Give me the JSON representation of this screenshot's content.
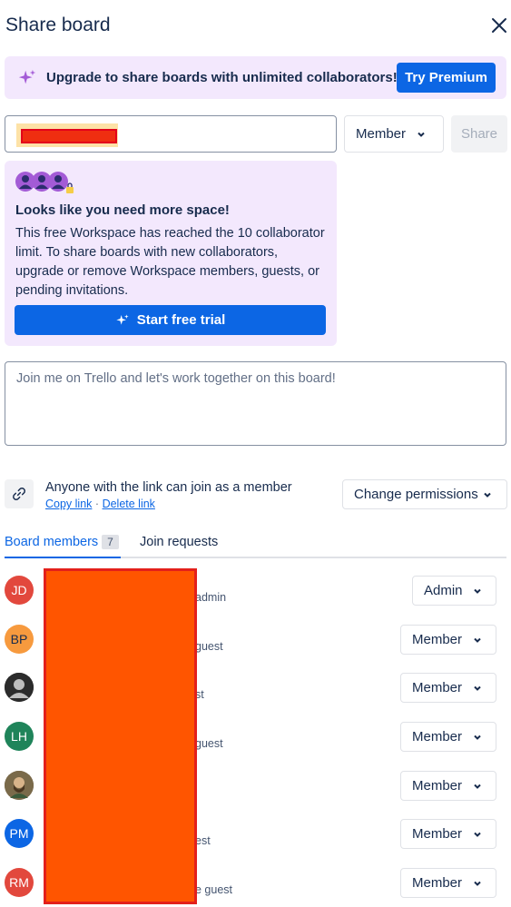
{
  "header": {
    "title": "Share board"
  },
  "upgrade_banner": {
    "text": "Upgrade to share boards with unlimited collaborators!",
    "button": "Try Premium"
  },
  "invite": {
    "role": "Member",
    "share_button": "Share"
  },
  "limit_card": {
    "title": "Looks like you need more space!",
    "body": "This free Workspace has reached the 10 collaborator limit. To share boards with new collaborators, upgrade or remove Workspace members, guests, or pending invitations.",
    "button": "Start free trial"
  },
  "message": {
    "placeholder": "Join me on Trello and let's work together on this board!"
  },
  "link": {
    "text": "Anyone with the link can join as a member",
    "copy": "Copy link",
    "separator": "·",
    "delete": "Delete link",
    "change_permissions": "Change permissions"
  },
  "tabs": {
    "members": "Board members",
    "members_count": "7",
    "requests": "Join requests"
  },
  "members": [
    {
      "initials": "JD",
      "color": "#e2483d",
      "role_fragment": "admin",
      "role": "Admin"
    },
    {
      "initials": "BP",
      "color": "#f79a3e",
      "role_fragment": "guest",
      "role": "Member"
    },
    {
      "initials": "",
      "color": "#3a3a3a",
      "role_fragment": "st",
      "role": "Member"
    },
    {
      "initials": "LH",
      "color": "#1f845a",
      "role_fragment": "guest",
      "role": "Member"
    },
    {
      "initials": "",
      "color": "#6b5a3a",
      "role_fragment": "",
      "role": "Member"
    },
    {
      "initials": "PM",
      "color": "#0c66e4",
      "role_fragment": "est",
      "role": "Member"
    },
    {
      "initials": "RM",
      "color": "#e2483d",
      "role_fragment": "e guest",
      "role": "Member"
    }
  ],
  "colors": {
    "accent": "#0c66e4",
    "banner_bg": "#f3e8fd"
  },
  "icons": {
    "close": "close-icon",
    "sparkle": "sparkle-icon",
    "link": "link-icon",
    "chevron": "chevron-down-icon"
  }
}
